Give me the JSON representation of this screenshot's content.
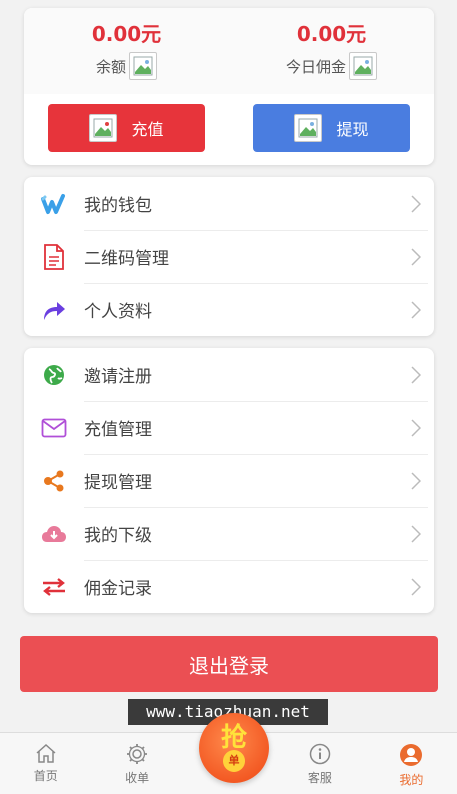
{
  "balance": {
    "amount": "0.00元",
    "label": "余额"
  },
  "commission": {
    "amount": "0.00元",
    "label": "今日佣金"
  },
  "actions": {
    "recharge_label": "充值",
    "withdraw_label": "提现"
  },
  "menu_group_1": [
    {
      "label": "我的钱包",
      "icon": "wallet-icon",
      "color": "#3aa0e8"
    },
    {
      "label": "二维码管理",
      "icon": "document-icon",
      "color": "#e0313a"
    },
    {
      "label": "个人资料",
      "icon": "share-arrow-icon",
      "color": "#6a3fe0"
    }
  ],
  "menu_group_2": [
    {
      "label": "邀请注册",
      "icon": "globe-icon",
      "color": "#3daa4a"
    },
    {
      "label": "充值管理",
      "icon": "envelope-icon",
      "color": "#b04fd8"
    },
    {
      "label": "提现管理",
      "icon": "share-nodes-icon",
      "color": "#e8781e"
    },
    {
      "label": "我的下级",
      "icon": "cloud-download-icon",
      "color": "#e87a9a"
    },
    {
      "label": "佣金记录",
      "icon": "transfer-arrows-icon",
      "color": "#e0313a"
    }
  ],
  "logout_label": "退出登录",
  "watermark": "www.tiaozhuan.net",
  "bottom_nav": {
    "home": "首页",
    "orders": "收单",
    "grab": "抢",
    "grab_sub": "单",
    "service": "客服",
    "mine": "我的"
  },
  "colors": {
    "accent_red": "#e7343b",
    "accent_blue": "#4a7de0",
    "active_nav": "#ea6b2e"
  }
}
